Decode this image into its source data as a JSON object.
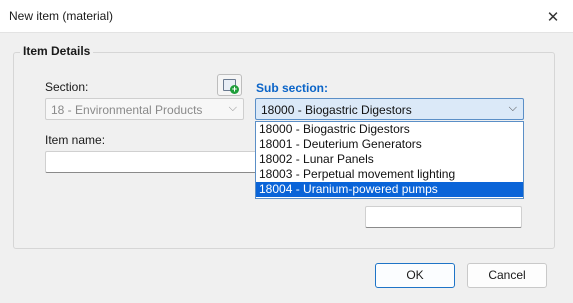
{
  "window": {
    "title": "New item (material)"
  },
  "group": {
    "legend": "Item Details"
  },
  "section": {
    "label": "Section:",
    "value": "18 - Environmental Products"
  },
  "sub_section": {
    "label": "Sub section:",
    "value": "18000 - Biogastric Digestors",
    "options": [
      "18000 - Biogastric Digestors",
      "18001 - Deuterium Generators",
      "18002 - Lunar Panels",
      "18003 - Perpetual movement lighting",
      "18004 - Uranium-powered pumps"
    ],
    "highlighted_index": 4
  },
  "item_name": {
    "label": "Item name:",
    "value": ""
  },
  "buttons": {
    "ok": "OK",
    "cancel": "Cancel"
  },
  "colors": {
    "accent": "#0a64c8",
    "selection": "#0a64d8"
  }
}
